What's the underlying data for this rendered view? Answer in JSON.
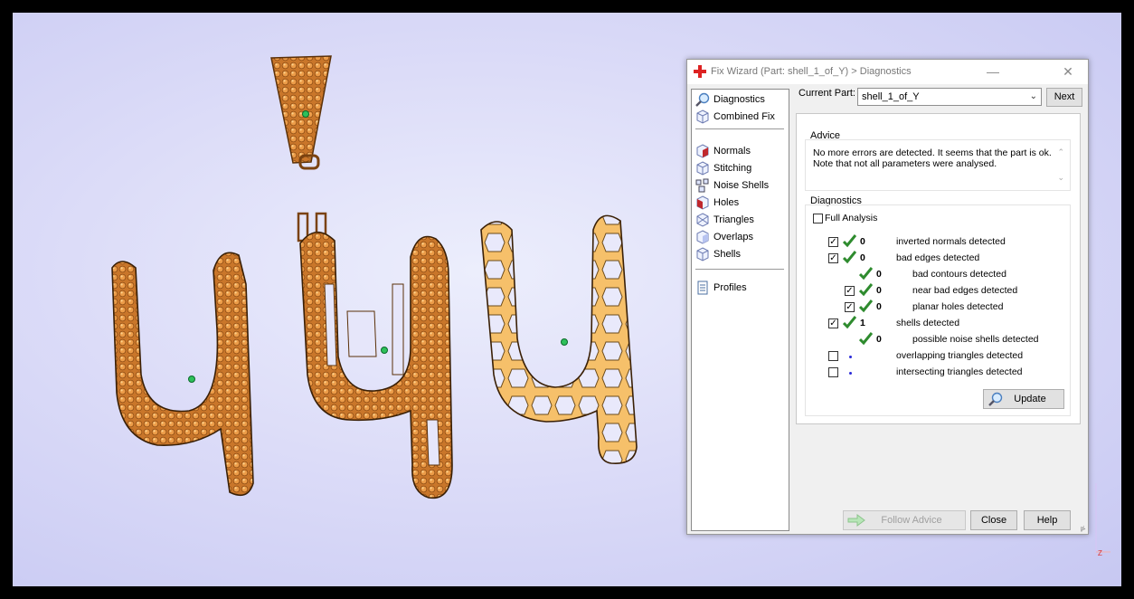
{
  "window": {
    "title": "Fix Wizard (Part: shell_1_of_Y) > Diagnostics",
    "minimize": "—",
    "close": "✕"
  },
  "nav": {
    "items": [
      {
        "label": "Diagnostics",
        "icon": "magnifier-icon"
      },
      {
        "label": "Combined Fix",
        "icon": "cube-icon"
      },
      {
        "label": "Normals",
        "icon": "normals-icon"
      },
      {
        "label": "Stitching",
        "icon": "stitching-icon"
      },
      {
        "label": "Noise Shells",
        "icon": "noise-shells-icon"
      },
      {
        "label": "Holes",
        "icon": "holes-icon"
      },
      {
        "label": "Triangles",
        "icon": "triangles-icon"
      },
      {
        "label": "Overlaps",
        "icon": "overlaps-icon"
      },
      {
        "label": "Shells",
        "icon": "shells-icon"
      },
      {
        "label": "Profiles",
        "icon": "profiles-icon"
      }
    ]
  },
  "current_part": {
    "label": "Current Part:",
    "value": "shell_1_of_Y",
    "next_label": "Next"
  },
  "advice": {
    "heading": "Advice",
    "line1": "No more errors are detected. It seems that the part is ok.",
    "line2": "Note that not all parameters were analysed."
  },
  "diagnostics": {
    "heading": "Diagnostics",
    "full_analysis_label": "Full Analysis",
    "full_analysis_checked": false,
    "rows": [
      {
        "label": "inverted normals detected",
        "count": "0",
        "checked": true,
        "status": "ok"
      },
      {
        "label": "bad edges detected",
        "count": "0",
        "checked": true,
        "status": "ok"
      },
      {
        "label": "bad contours detected",
        "count": "0",
        "checked": null,
        "status": "ok"
      },
      {
        "label": "near bad edges detected",
        "count": "0",
        "checked": true,
        "status": "ok"
      },
      {
        "label": "planar holes detected",
        "count": "0",
        "checked": true,
        "status": "ok"
      },
      {
        "label": "shells detected",
        "count": "1",
        "checked": true,
        "status": "ok"
      },
      {
        "label": "possible noise shells detected",
        "count": "0",
        "checked": null,
        "status": "ok"
      },
      {
        "label": "overlapping triangles detected",
        "count": "",
        "checked": false,
        "status": "not-analysed"
      },
      {
        "label": "intersecting triangles detected",
        "count": "",
        "checked": false,
        "status": "not-analysed"
      }
    ],
    "update_label": "Update"
  },
  "footer": {
    "follow_advice": "Follow Advice",
    "close": "Close",
    "help": "Help"
  },
  "colors": {
    "gold": "#e0903e",
    "gold_light": "#f8c774",
    "check": "#2e8b2e",
    "accent_red": "#d22"
  }
}
